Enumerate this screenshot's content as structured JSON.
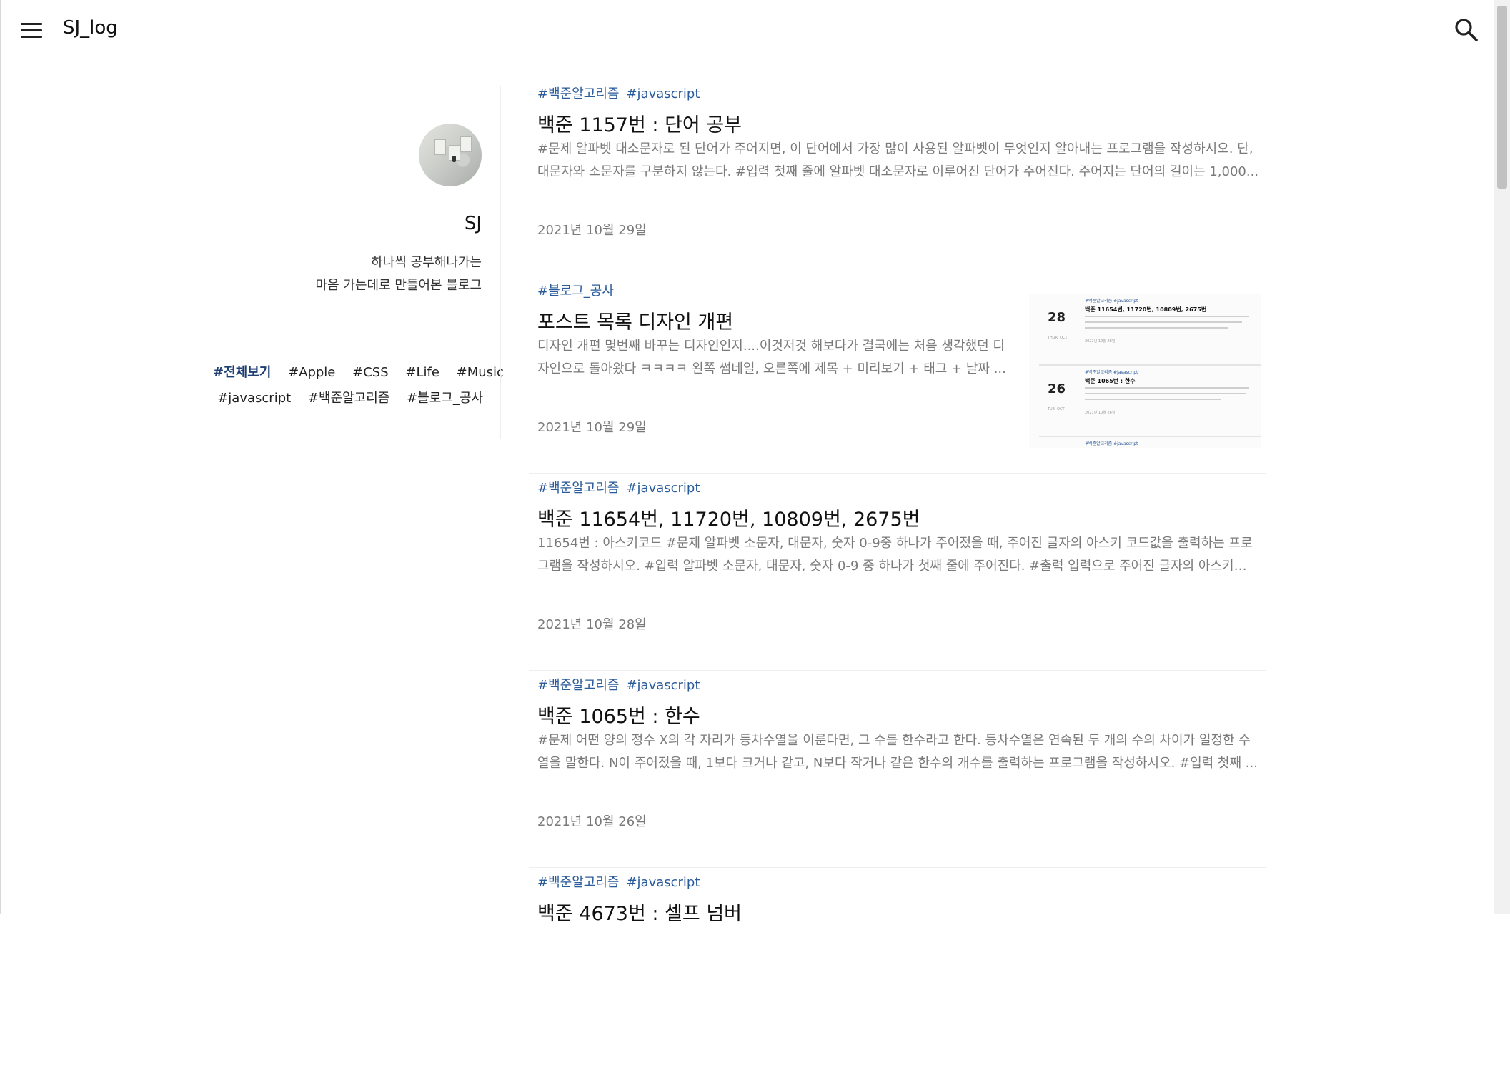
{
  "header": {
    "menu_icon": "hamburger-menu-icon",
    "logo": "SJ_log",
    "search_icon": "search-icon"
  },
  "profile": {
    "name": "SJ",
    "bio_line1": "하나씩 공부해나가는",
    "bio_line2": "마음 가는데로 만들어본 블로그"
  },
  "tags": [
    {
      "label": "#전체보기",
      "active": true
    },
    {
      "label": "#Apple"
    },
    {
      "label": "#CSS"
    },
    {
      "label": "#Life"
    },
    {
      "label": "#Music"
    },
    {
      "label": "#javascript"
    },
    {
      "label": "#백준알고리즘"
    },
    {
      "label": "#블로그_공사"
    }
  ],
  "posts": [
    {
      "tags": [
        "#백준알고리즘",
        "#javascript"
      ],
      "title": "백준 1157번 : 단어 공부",
      "excerpt": "#문제 알파벳 대소문자로 된 단어가 주어지면, 이 단어에서 가장 많이 사용된 알파벳이 무엇인지 알아내는 프로그램을 작성하시오. 단, 대문자와 소문자를 구분하지 않는다. #입력 첫째 줄에 알파벳 대소문자로 이루어진 단어가 주어진다. 주어지는 단어의 길이는 1,000...",
      "date": "2021년 10월 29일"
    },
    {
      "tags": [
        "#블로그_공사"
      ],
      "title": "포스트 목록 디자인 개편",
      "excerpt": "디자인 개편 몇번째 바꾸는 디자인인지....이것저것 해보다가 결국에는 처음 생각했던 디자인으로 돌아왔다 ㅋㅋㅋㅋ 왼쪽 썸네일, 오른쪽에 제목 + 미리보기 + 태그 + 날짜 ...",
      "date": "2021년 10월 29일",
      "thumbnail": {
        "cards": [
          {
            "day": "28",
            "dow": "THUR, OCT",
            "tags": "#백준알고리즘   #javascript",
            "title": "백준 11654번, 11720번, 10809번, 2675번",
            "date": "2021년 10월 28일"
          },
          {
            "day": "26",
            "dow": "TUE, OCT",
            "tags": "#백준알고리즘   #javascript",
            "title": "백준 1065번 : 한수",
            "date": "2021년 10월 26일"
          },
          {
            "tags": "#백준알고리즘   #javascript"
          }
        ]
      }
    },
    {
      "tags": [
        "#백준알고리즘",
        "#javascript"
      ],
      "title": "백준 11654번, 11720번, 10809번, 2675번",
      "excerpt": "11654번 : 아스키코드 #문제 알파벳 소문자, 대문자, 숫자 0-9중 하나가 주어졌을 때, 주어진 글자의 아스키 코드값을 출력하는 프로그램을 작성하시오. #입력 알파벳 소문자, 대문자, 숫자 0-9 중 하나가 첫째 줄에 주어진다. #출력 입력으로 주어진 글자의 아스키 코...",
      "date": "2021년 10월 28일"
    },
    {
      "tags": [
        "#백준알고리즘",
        "#javascript"
      ],
      "title": "백준 1065번 : 한수",
      "excerpt": "#문제 어떤 양의 정수 X의 각 자리가 등차수열을 이룬다면, 그 수를 한수라고 한다. 등차수열은 연속된 두 개의 수의 차이가 일정한 수열을 말한다. N이 주어졌을 때, 1보다 크거나 같고, N보다 작거나 같은 한수의 개수를 출력하는 프로그램을 작성하시오. #입력 첫째 ...",
      "date": "2021년 10월 26일"
    },
    {
      "tags": [
        "#백준알고리즘",
        "#javascript"
      ],
      "title": "백준 4673번 : 셀프 넘버"
    }
  ],
  "colors": {
    "tag_link": "#2a5b9a",
    "active_tag": "#1f3f74",
    "muted_text": "#7a7a7a"
  }
}
